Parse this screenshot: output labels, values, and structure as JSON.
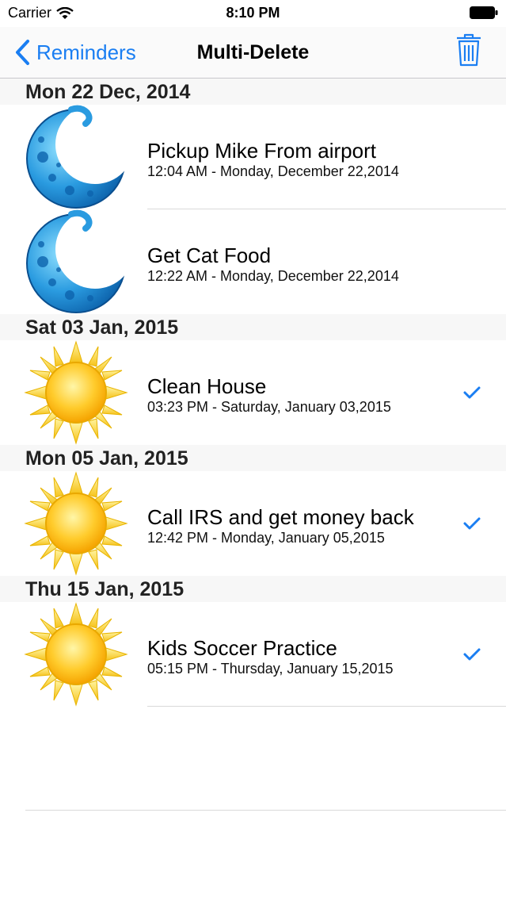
{
  "status_bar": {
    "carrier": "Carrier",
    "time": "8:10 PM"
  },
  "nav": {
    "back_label": "Reminders",
    "title": "Multi-Delete"
  },
  "colors": {
    "accent": "#1a7ef2",
    "section_bg": "#f7f7f7"
  },
  "sections": [
    {
      "header": "Mon 22 Dec, 2014",
      "items": [
        {
          "title": "Pickup Mike From airport",
          "subtitle": "12:04 AM - Monday, December 22,2014",
          "icon": "moon-icon",
          "checked": false
        },
        {
          "title": "Get Cat Food",
          "subtitle": "12:22 AM - Monday, December 22,2014",
          "icon": "moon-icon",
          "checked": false
        }
      ]
    },
    {
      "header": "Sat 03 Jan, 2015",
      "items": [
        {
          "title": "Clean House",
          "subtitle": "03:23 PM - Saturday, January 03,2015",
          "icon": "sun-icon",
          "checked": true
        }
      ]
    },
    {
      "header": "Mon 05 Jan, 2015",
      "items": [
        {
          "title": "Call IRS and get money back",
          "subtitle": "12:42 PM - Monday, January 05,2015",
          "icon": "sun-icon",
          "checked": true
        }
      ]
    },
    {
      "header": "Thu 15 Jan, 2015",
      "items": [
        {
          "title": "Kids Soccer Practice",
          "subtitle": "05:15 PM - Thursday, January 15,2015",
          "icon": "sun-icon",
          "checked": true
        }
      ]
    }
  ]
}
